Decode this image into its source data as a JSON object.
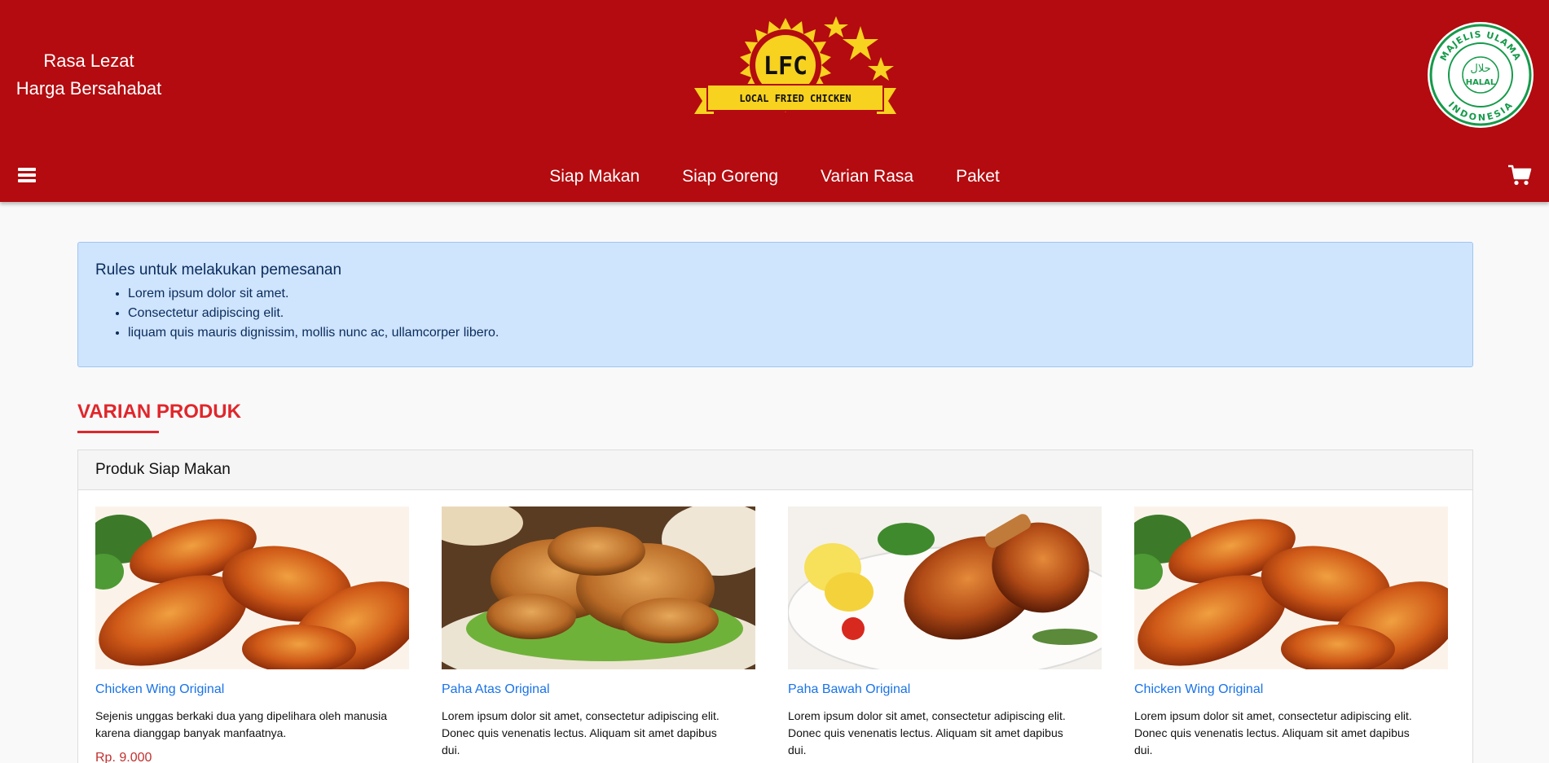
{
  "header": {
    "tagline_line1": "Rasa Lezat",
    "tagline_line2": "Harga Bersahabat",
    "logo_text": "LFC",
    "logo_subtext": "LOCAL FRIED CHICKEN",
    "halal_top": "MAJELIS ULAMA",
    "halal_bottom": "INDONESIA",
    "halal_center": "HALAL",
    "halal_arabic": "حلال"
  },
  "nav": {
    "items": [
      {
        "label": "Siap Makan"
      },
      {
        "label": "Siap Goreng"
      },
      {
        "label": "Varian Rasa"
      },
      {
        "label": "Paket"
      }
    ]
  },
  "icons": {
    "menu": "hamburger-menu-icon",
    "cart": "shopping-cart-icon"
  },
  "rules": {
    "title": "Rules untuk melakukan pemesanan",
    "items": [
      "Lorem ipsum dolor sit amet.",
      "Consectetur adipiscing elit.",
      "liquam quis mauris dignissim, mollis nunc ac, ullamcorper libero."
    ]
  },
  "section": {
    "title": "VARIAN PRODUK"
  },
  "panel": {
    "title": "Produk Siap Makan",
    "products": [
      {
        "name": "Chicken Wing Original",
        "description": "Sejenis unggas berkaki dua yang dipelihara oleh manusia karena dianggap banyak manfaatnya.",
        "price": "Rp. 9.000",
        "image": "wings"
      },
      {
        "name": "Paha Atas Original",
        "description": "Lorem ipsum dolor sit amet, consectetur adipiscing elit. Donec quis venenatis lectus. Aliquam sit amet dapibus dui.",
        "price": "",
        "image": "fried"
      },
      {
        "name": "Paha Bawah Original",
        "description": "Lorem ipsum dolor sit amet, consectetur adipiscing elit. Donec quis venenatis lectus. Aliquam sit amet dapibus dui.",
        "price": "",
        "image": "drumstick"
      },
      {
        "name": "Chicken Wing Original",
        "description": "Lorem ipsum dolor sit amet, consectetur adipiscing elit. Donec quis venenatis lectus. Aliquam sit amet dapibus dui.",
        "price": "",
        "image": "wings"
      }
    ]
  },
  "colors": {
    "header_bg": "#b30b0f",
    "accent_red": "#e0262b",
    "link_blue": "#1a73e8",
    "alert_bg": "#cfe4fd",
    "logo_yellow": "#f7d21f",
    "halal_green": "#159a4a"
  }
}
